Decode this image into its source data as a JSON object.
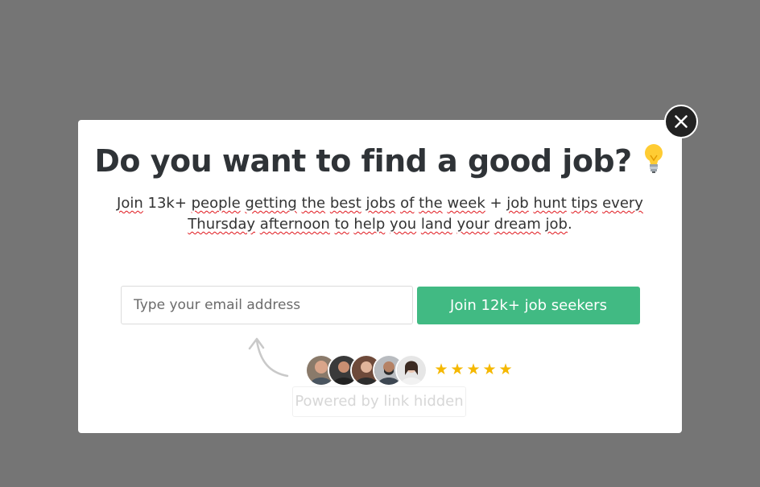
{
  "popup": {
    "headline": "Do you want to find a good job?",
    "headline_icon": "lightbulb-icon",
    "subtext_line1_parts": [
      "Join",
      " 13k+ ",
      "people",
      " ",
      "getting",
      " ",
      "the",
      " ",
      "best",
      " ",
      "jobs",
      " ",
      "of",
      " ",
      "the",
      " ",
      "week",
      " + ",
      "job",
      " ",
      "hunt",
      " ",
      "tips",
      " ",
      "every"
    ],
    "subtext_line2_parts": [
      "Thursday",
      " ",
      "afternoon",
      " ",
      "to",
      " ",
      "help",
      " ",
      "you",
      " ",
      "land",
      " ",
      "your",
      " ",
      "dream",
      " ",
      "job",
      "."
    ],
    "email_placeholder": "Type your email address",
    "submit_label": "Join 12k+ job seekers",
    "rating_stars": 5,
    "powered_by": "Powered by link hidden"
  },
  "colors": {
    "overlay": "#757575",
    "accent_button": "#41ba83",
    "star": "#f5b800",
    "close_button": "#222222"
  }
}
